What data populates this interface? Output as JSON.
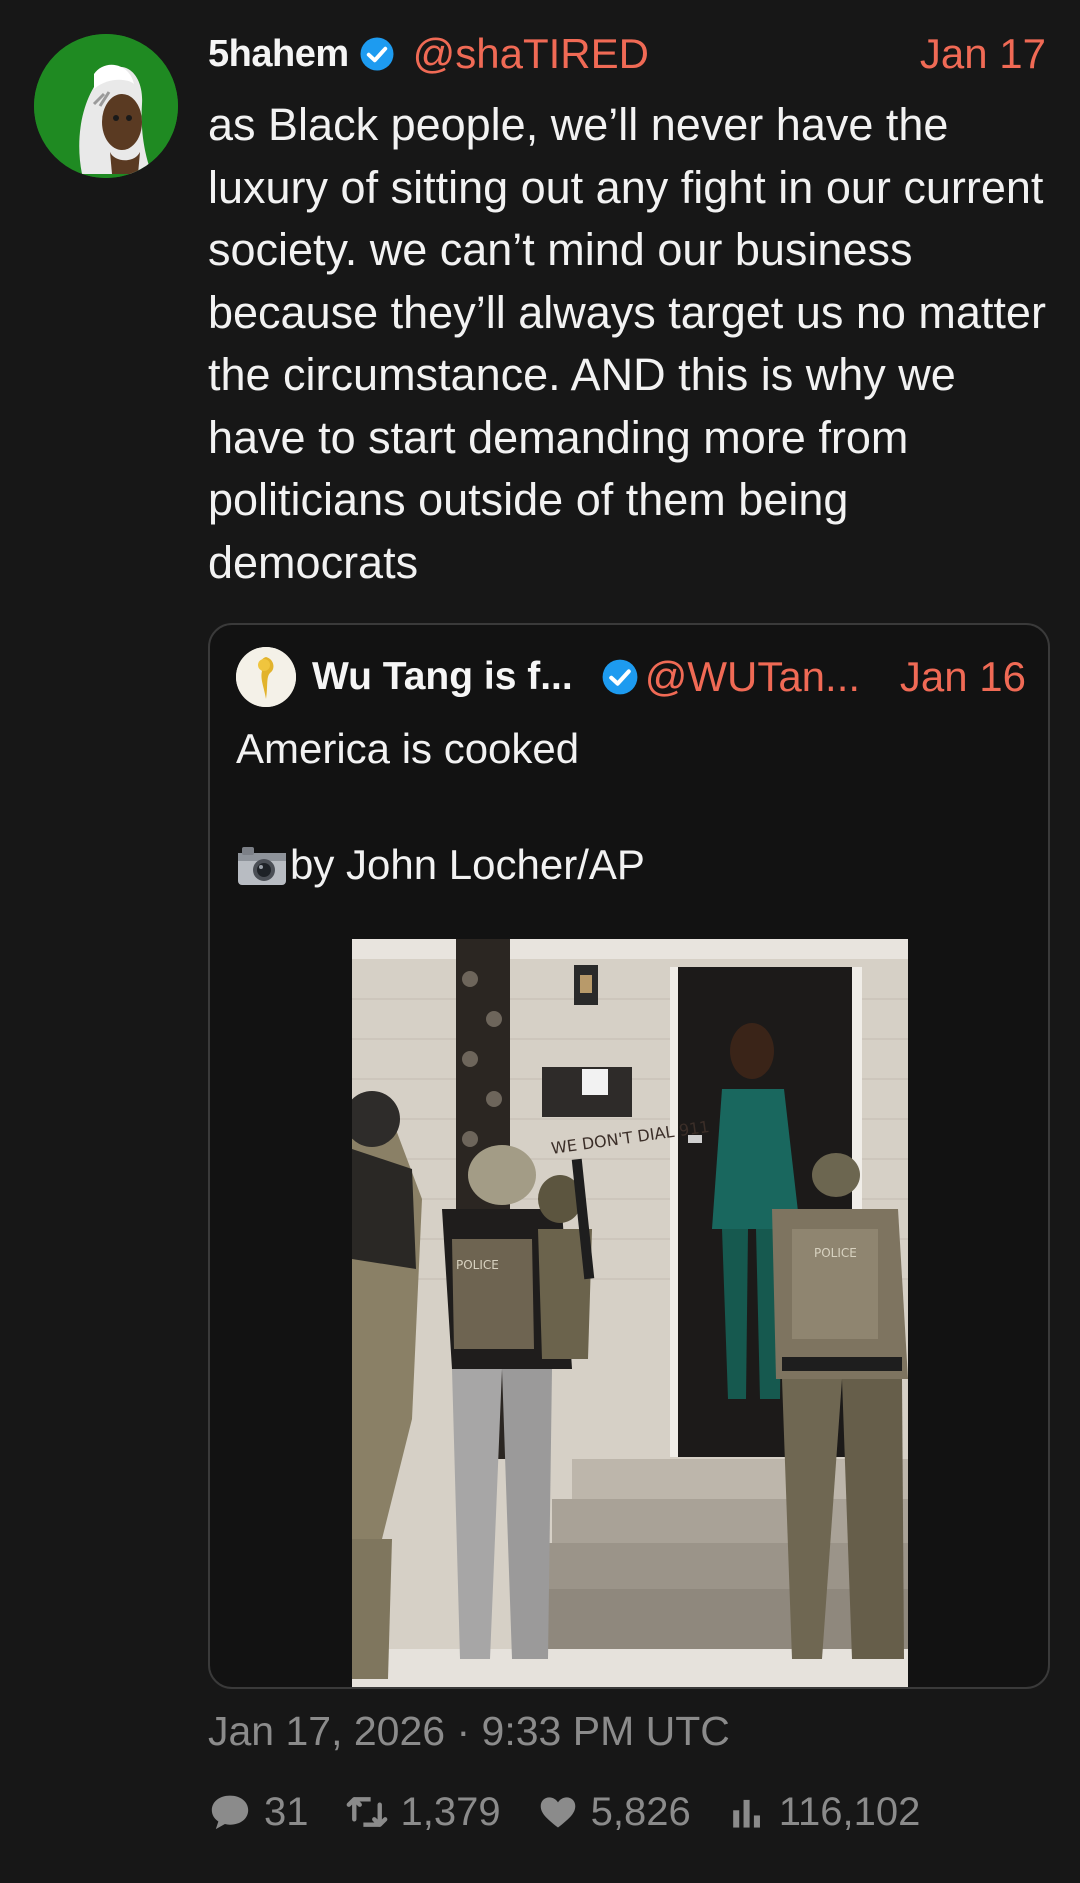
{
  "tweet": {
    "author_name": "5hahem",
    "handle": "@shaTIRED",
    "date": "Jan 17",
    "text": "as Black people, we’ll never have the luxury of sitting out any fight in our current society. we can’t mind our business because they’ll always target us no matter the circumstance. AND this is why we have to start demanding more from politicians outside of them being democrats",
    "timestamp": "Jan 17, 2026 · 9:33 PM UTC"
  },
  "quote": {
    "author_name": "Wu Tang is f...",
    "handle": "@WUTan...",
    "date": "Jan 16",
    "line1": "America is cooked",
    "line2": "by John Locher/AP",
    "photo_sign": "WE DON'T DIAL 911",
    "vest_label": "POLICE"
  },
  "stats": {
    "replies": "31",
    "retweets": "1,379",
    "likes": "5,826",
    "views": "116,102"
  },
  "colors": {
    "background": "#171717",
    "accent": "#f06a55",
    "verified": "#1d9bf0",
    "muted": "#8b8b8b",
    "avatar_bg": "#1f8a22"
  },
  "icons": [
    "verified-badge-icon",
    "camera-icon",
    "reply-icon",
    "retweet-icon",
    "like-icon",
    "views-icon"
  ]
}
